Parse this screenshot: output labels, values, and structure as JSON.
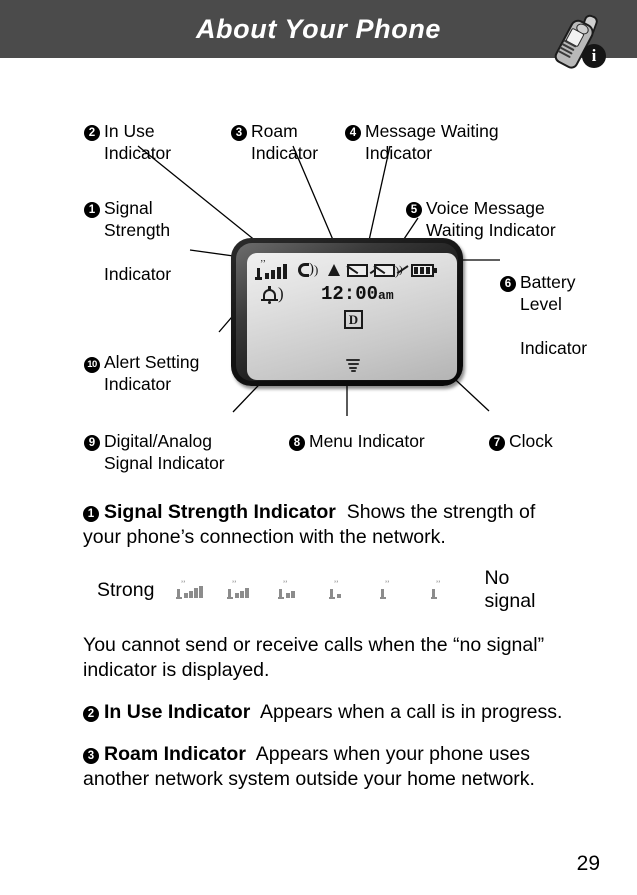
{
  "header": {
    "title": "About Your Phone",
    "icon_name": "phone-info-icon",
    "badge_glyph": "i",
    "bar_color": "#4b4b4b"
  },
  "diagram": {
    "title": "Phone display indicator callouts",
    "phone_display": {
      "clock": "12:00",
      "clock_ampm": "am",
      "digital_letter": "D",
      "statusbar_icons": [
        "signal-strength-icon",
        "in-use-icon",
        "roam-icon",
        "message-waiting-icon",
        "voice-message-waiting-icon",
        "battery-level-icon"
      ],
      "battery_segments": 3,
      "signal_bars": 4,
      "alert_icon": "alert-bell-icon",
      "menu_icon": "menu-indicator-icon"
    },
    "callouts": [
      {
        "num": "2",
        "line1": "In Use",
        "line2": "Indicator",
        "name": "callout-in-use-indicator"
      },
      {
        "num": "3",
        "line1": "Roam",
        "line2": "Indicator",
        "name": "callout-roam-indicator"
      },
      {
        "num": "4",
        "line1": "Message Waiting",
        "line2": "Indicator",
        "name": "callout-message-waiting-indicator"
      },
      {
        "num": "1",
        "line1": "Signal",
        "line2": "Strength",
        "line3": "Indicator",
        "name": "callout-signal-strength-indicator"
      },
      {
        "num": "5",
        "line1": "Voice Message",
        "line2": "Waiting Indicator",
        "name": "callout-voice-message-waiting-indicator"
      },
      {
        "num": "6",
        "line1": "Battery",
        "line2": "Level",
        "line3": "Indicator",
        "name": "callout-battery-level-indicator"
      },
      {
        "num": "10",
        "line1": "Alert Setting",
        "line2": "Indicator",
        "name": "callout-alert-setting-indicator"
      },
      {
        "num": "9",
        "line1": "Digital/Analog",
        "line2": "Signal Indicator",
        "name": "callout-digital-analog-signal-indicator"
      },
      {
        "num": "8",
        "line1": "Menu Indicator",
        "line2": "",
        "name": "callout-menu-indicator"
      },
      {
        "num": "7",
        "line1": "Clock",
        "line2": "",
        "name": "callout-clock"
      }
    ]
  },
  "body": {
    "entries": [
      {
        "num": "1",
        "term": "Signal Strength Indicator",
        "text": "Shows the strength of your phone’s connection with the network."
      },
      {
        "num": "2",
        "term": "In Use Indicator",
        "text": "Appears when a call is in progress."
      },
      {
        "num": "3",
        "term": "Roam Indicator",
        "text": "Appears when your phone uses another network system outside your home network."
      }
    ],
    "note": "You cannot send or receive calls when the “no signal” indicator is displayed."
  },
  "signal_scale": {
    "left_label": "Strong",
    "right_label": "No signal",
    "bars": [
      4,
      3,
      2,
      1,
      0,
      0
    ]
  },
  "footer": {
    "page_number": "29"
  }
}
